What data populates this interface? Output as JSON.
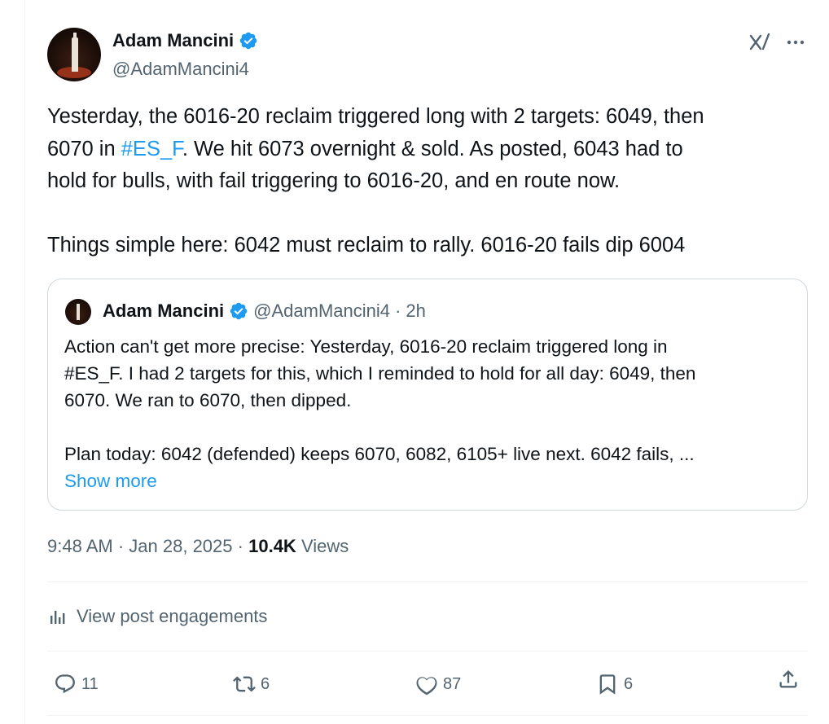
{
  "author": {
    "display_name": "Adam Mancini",
    "handle": "@AdamMancini4"
  },
  "icons": {
    "verified": "verified-badge-icon",
    "grok": "grok-icon",
    "more": "more-icon",
    "reply": "reply-icon",
    "repost": "repost-icon",
    "like": "like-icon",
    "bookmark": "bookmark-icon",
    "share": "share-icon",
    "analytics": "analytics-icon"
  },
  "colors": {
    "link": "#1d9bf0",
    "verified": "#1d9bf0",
    "secondary_text": "#536471"
  },
  "tweet": {
    "line1": "Yesterday, the 6016-20 reclaim triggered long with 2 targets: 6049, then",
    "line2_pre": "6070 in ",
    "line2_hashtag": "#ES_F",
    "line2_post": ". We hit 6073 overnight & sold. As posted, 6043 had to",
    "line3": "hold for bulls, with fail triggering to 6016-20, and en route now.",
    "line4": "Things simple here: 6042 must reclaim to rally. 6016-20 fails dip 6004"
  },
  "quote": {
    "display_name": "Adam Mancini",
    "handle": "@AdamMancini4",
    "separator": "·",
    "time": "2h",
    "line1": "Action can't get more precise: Yesterday, 6016-20 reclaim triggered long in",
    "line2": "#ES_F. I had 2 targets for this, which I reminded to hold for all day: 6049, then",
    "line3": "6070. We ran to 6070, then dipped.",
    "line4": "Plan today: 6042 (defended) keeps 6070, 6082, 6105+ live next. 6042 fails, ...",
    "show_more": "Show more"
  },
  "meta": {
    "time": "9:48 AM",
    "sep1": "·",
    "date": "Jan 28, 2025",
    "sep2": "·",
    "views_count": "10.4K",
    "views_label": "Views"
  },
  "engagements_label": "View post engagements",
  "actions": {
    "replies": "11",
    "reposts": "6",
    "likes": "87",
    "bookmarks": "6"
  }
}
